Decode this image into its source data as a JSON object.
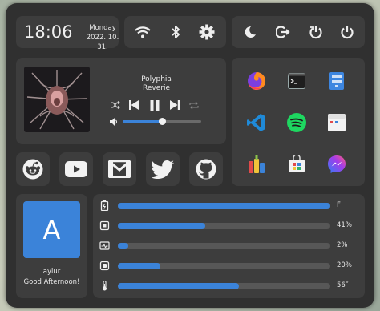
{
  "clock": {
    "time": "18:06",
    "weekday": "Monday",
    "date": "2022. 10. 31."
  },
  "quick_toggles": [
    {
      "name": "wifi-icon"
    },
    {
      "name": "bluetooth-icon"
    },
    {
      "name": "gear-icon"
    }
  ],
  "power_buttons": [
    {
      "name": "moon-icon"
    },
    {
      "name": "logout-icon"
    },
    {
      "name": "restart-icon"
    },
    {
      "name": "power-icon"
    }
  ],
  "media": {
    "title": "Polyphia",
    "artist": "Reverie",
    "volume": 0.5,
    "controls": [
      "shuffle-icon",
      "previous-icon",
      "pause-icon",
      "next-icon",
      "repeat-icon"
    ]
  },
  "apps": [
    "firefox-icon",
    "terminal-icon",
    "file-manager-icon",
    "vscode-icon",
    "spotify-icon",
    "calendar-icon",
    "paint-icon",
    "store-icon",
    "messenger-icon"
  ],
  "social": [
    "reddit-icon",
    "youtube-icon",
    "gmail-icon",
    "twitter-icon",
    "github-icon"
  ],
  "user": {
    "initial": "A",
    "name": "aylur",
    "greeting": "Good Afternoon!"
  },
  "stats": [
    {
      "icon": "battery-icon",
      "value": 1.0,
      "label": "F"
    },
    {
      "icon": "cpu-icon",
      "value": 0.41,
      "label": "41%"
    },
    {
      "icon": "memory-icon",
      "value": 0.02,
      "label": "2%"
    },
    {
      "icon": "disk-icon",
      "value": 0.2,
      "label": "20%"
    },
    {
      "icon": "thermometer-icon",
      "value": 0.57,
      "label": "56˚"
    }
  ],
  "colors": {
    "accent": "#3b83d9",
    "panel": "#303030",
    "card": "#3d3d3d"
  }
}
